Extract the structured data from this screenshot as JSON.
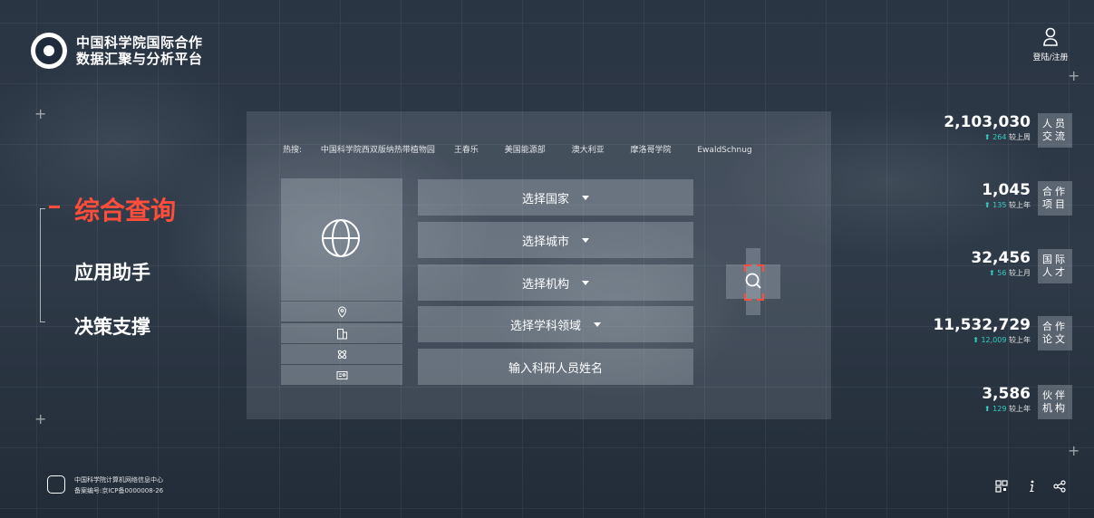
{
  "header": {
    "title_line1": "中国科学院国际合作",
    "title_line2": "数据汇聚与分析平台",
    "login_label": "登陆/注册"
  },
  "nav": {
    "items": [
      {
        "label": "综合查询",
        "active": true
      },
      {
        "label": "应用助手",
        "active": false
      },
      {
        "label": "决策支撑",
        "active": false
      }
    ]
  },
  "search": {
    "hot_label": "热搜:",
    "hot_terms": [
      "中国科学院西双版纳热带植物园",
      "王春乐",
      "美国能源部",
      "澳大利亚",
      "摩洛哥学院",
      "EwaldSchnug"
    ],
    "selects": [
      {
        "label": "选择国家"
      },
      {
        "label": "选择城市"
      },
      {
        "label": "选择机构"
      },
      {
        "label": "选择学科领域"
      }
    ],
    "name_input_placeholder": "输入科研人员姓名",
    "left_icons": [
      "globe-icon",
      "location-icon",
      "building-icon",
      "atom-icon",
      "id-card-icon"
    ]
  },
  "stats": [
    {
      "value": "2,103,030",
      "delta": "264",
      "period": "较上周",
      "tag_line1": "人员",
      "tag_line2": "交流"
    },
    {
      "value": "1,045",
      "delta": "135",
      "period": "较上年",
      "tag_line1": "合作",
      "tag_line2": "项目"
    },
    {
      "value": "32,456",
      "delta": "56",
      "period": "较上月",
      "tag_line1": "国际",
      "tag_line2": "人才"
    },
    {
      "value": "11,532,729",
      "delta": "12,009",
      "period": "较上年",
      "tag_line1": "合作",
      "tag_line2": "论文"
    },
    {
      "value": "3,586",
      "delta": "129",
      "period": "较上年",
      "tag_line1": "伙伴",
      "tag_line2": "机构"
    }
  ],
  "footer": {
    "org": "中国科学院计算机网络信息中心",
    "icp": "备案编号:京ICP备0000008-26",
    "icons": [
      "qr-code-icon",
      "info-icon",
      "share-icon"
    ]
  },
  "colors": {
    "accent": "#ff4d3b",
    "up": "#33d0c4",
    "background": "#2b3644"
  }
}
